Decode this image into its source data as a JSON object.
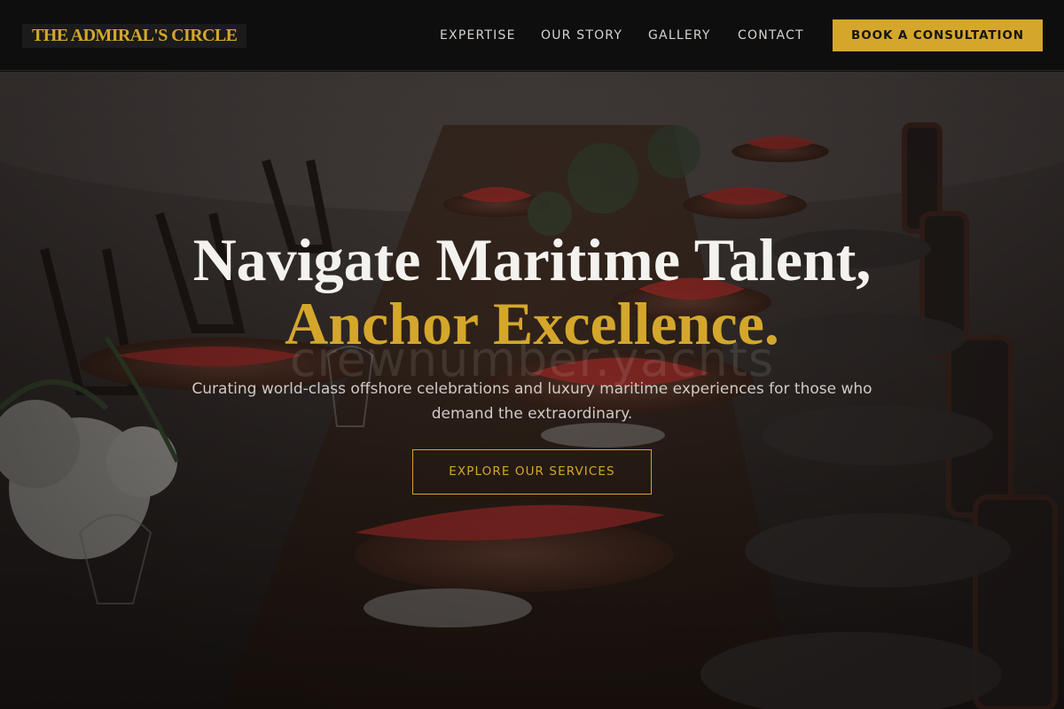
{
  "brand": {
    "name": "THE ADMIRAL'S CIRCLE"
  },
  "nav": {
    "items": [
      {
        "label": "EXPERTISE"
      },
      {
        "label": "OUR STORY"
      },
      {
        "label": "GALLERY"
      },
      {
        "label": "CONTACT"
      }
    ],
    "cta_label": "BOOK A CONSULTATION"
  },
  "hero": {
    "headline_line1": "Navigate Maritime Talent,",
    "headline_line2": "Anchor Excellence.",
    "watermark": "crewnumber.yachts",
    "subtitle": "Curating world-class offshore celebrations and luxury maritime experiences for those who demand the extraordinary.",
    "cta_label": "EXPLORE OUR SERVICES",
    "background_subject": "long outdoor dining table with red napkins and wooden chairs"
  },
  "colors": {
    "accent_gold": "#d4a72c",
    "header_bg": "#0f0e0e",
    "text_light": "#f4f2ef"
  }
}
